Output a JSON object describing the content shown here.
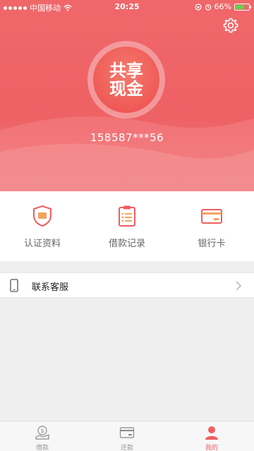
{
  "status_bar": {
    "carrier": "中国移动",
    "time": "20:25",
    "battery": "66%",
    "battery_level": 0.66
  },
  "header": {
    "logo": {
      "line1": "共享",
      "line2": "现金"
    },
    "phone_masked": "158587***56",
    "settings_icon": "gear-icon"
  },
  "shortcuts": [
    {
      "label": "认证资料",
      "icon": "shield-icon"
    },
    {
      "label": "借款记录",
      "icon": "clipboard-icon"
    },
    {
      "label": "银行卡",
      "icon": "bank-card-icon"
    }
  ],
  "contact": {
    "label": "联系客服",
    "icon": "phone-icon"
  },
  "tabbar": {
    "tabs": [
      {
        "label": "借款",
        "icon": "loan-icon",
        "active": false
      },
      {
        "label": "还款",
        "icon": "card-icon",
        "active": false
      },
      {
        "label": "我的",
        "icon": "user-icon",
        "active": true
      }
    ]
  },
  "colors": {
    "brand": "#ef5e61",
    "icon_accent": "#f08a4b",
    "background": "#efefef"
  }
}
